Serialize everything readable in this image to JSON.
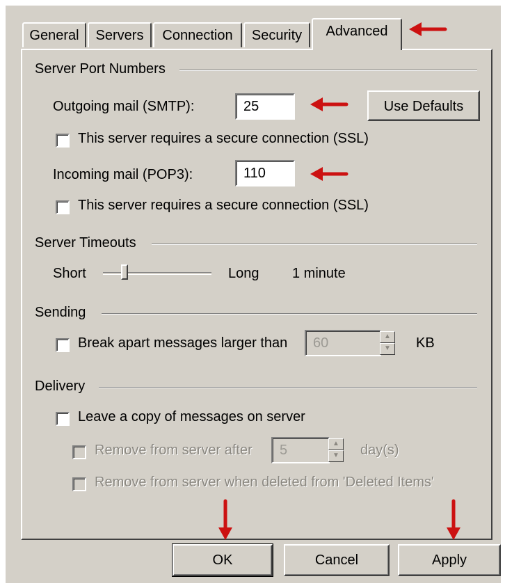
{
  "tabs": [
    {
      "label": "General"
    },
    {
      "label": "Servers"
    },
    {
      "label": "Connection"
    },
    {
      "label": "Security"
    },
    {
      "label": "Advanced"
    }
  ],
  "groups": {
    "ports": {
      "title": "Server Port Numbers",
      "smtp_label": "Outgoing mail (SMTP):",
      "smtp_value": "25",
      "use_defaults": "Use Defaults",
      "smtp_ssl": "This server requires a secure connection (SSL)",
      "pop3_label": "Incoming mail (POP3):",
      "pop3_value": "110",
      "pop3_ssl": "This server requires a secure connection (SSL)"
    },
    "timeouts": {
      "title": "Server Timeouts",
      "short": "Short",
      "long": "Long",
      "value_text": "1 minute",
      "slider_fraction": 0.18
    },
    "sending": {
      "title": "Sending",
      "break_label": "Break apart messages larger than",
      "size_value": "60",
      "unit": "KB"
    },
    "delivery": {
      "title": "Delivery",
      "leave_copy": "Leave a copy of messages on server",
      "remove_after": "Remove from server after",
      "days_value": "5",
      "days_unit": "day(s)",
      "remove_deleted": "Remove from server when deleted from 'Deleted Items'"
    }
  },
  "buttons": {
    "ok": "OK",
    "cancel": "Cancel",
    "apply": "Apply"
  },
  "colors": {
    "dialog_bg": "#d4d0c8",
    "annotation_arrow": "#cc1111"
  },
  "icons": [
    "red-arrow-icon"
  ]
}
